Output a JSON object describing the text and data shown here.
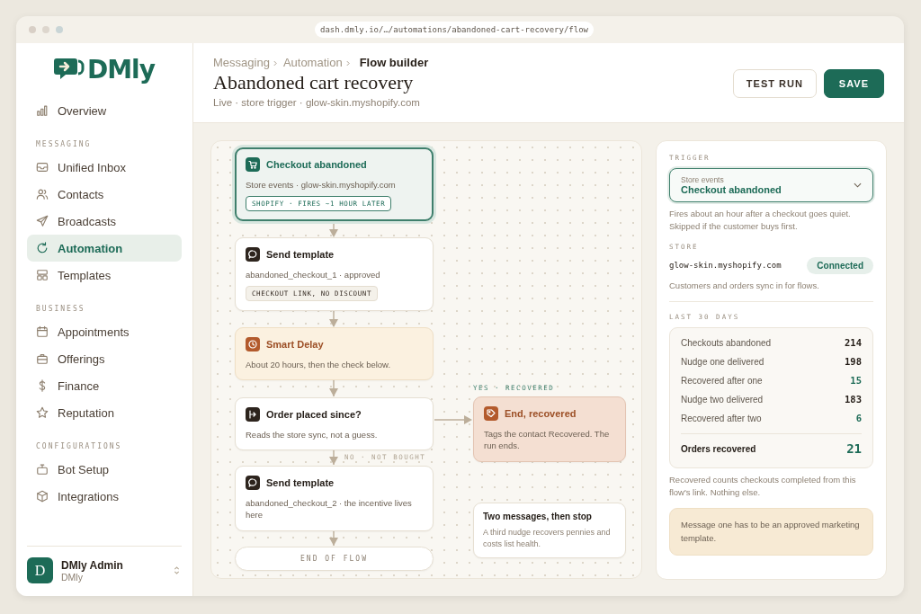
{
  "browser": {
    "url": "dash.dmly.io/…/automations/abandoned-cart-recovery/flow"
  },
  "sidebar": {
    "logo": "DMly",
    "sections": [
      {
        "items": [
          {
            "label": "Overview",
            "selected": false
          }
        ]
      },
      {
        "heading": "MESSAGING",
        "items": [
          {
            "label": "Unified Inbox",
            "selected": false
          },
          {
            "label": "Contacts",
            "selected": false
          },
          {
            "label": "Broadcasts",
            "selected": false
          },
          {
            "label": "Automation",
            "selected": true
          },
          {
            "label": "Templates",
            "selected": false
          }
        ]
      },
      {
        "heading": "BUSINESS",
        "items": [
          {
            "label": "Appointments",
            "selected": false
          },
          {
            "label": "Offerings",
            "selected": false
          },
          {
            "label": "Finance",
            "selected": false
          },
          {
            "label": "Reputation",
            "selected": false
          }
        ]
      },
      {
        "heading": "CONFIGURATIONS",
        "items": [
          {
            "label": "Bot Setup",
            "selected": false
          },
          {
            "label": "Integrations",
            "selected": false
          }
        ]
      }
    ],
    "user": {
      "initial": "D",
      "name": "DMly Admin",
      "org": "DMly"
    }
  },
  "header": {
    "breadcrumbs": [
      "Messaging",
      "Automation",
      "Flow builder"
    ],
    "title": "Abandoned cart recovery",
    "subtitle": "Live · store trigger · glow-skin.myshopify.com",
    "buttons": [
      {
        "label": "TEST RUN",
        "kind": "secondary"
      },
      {
        "label": "SAVE",
        "kind": "primary"
      }
    ]
  },
  "flow": {
    "nodes": [
      {
        "kind": "trigger",
        "title": "Checkout abandoned",
        "text": "Store events · glow-skin.myshopify.com",
        "tag": "SHOPIFY · FIRES ~1 HOUR LATER"
      },
      {
        "kind": "message",
        "title": "Send template",
        "text": "abandoned_checkout_1 · approved",
        "tag": "CHECKOUT LINK, NO DISCOUNT"
      },
      {
        "kind": "delay",
        "title": "Smart Delay",
        "text": "About 20 hours, then the check below."
      },
      {
        "kind": "condition",
        "title": "Order placed since?",
        "text": "Reads the store sync, not a guess."
      },
      {
        "kind": "message",
        "title": "Send template",
        "text": "abandoned_checkout_2 · the incentive lives here"
      },
      {
        "kind": "terminal",
        "title": "END OF FLOW"
      },
      {
        "kind": "end",
        "title": "End, recovered",
        "text": "Tags the contact Recovered. The run ends."
      },
      {
        "kind": "note",
        "title": "Two messages, then stop",
        "text": "A third nudge recovers pennies and costs list health."
      }
    ],
    "branches": [
      {
        "kind": "yes",
        "label": "YES · RECOVERED"
      },
      {
        "kind": "no",
        "label": "NO · NOT BOUGHT"
      }
    ]
  },
  "panel": {
    "trigger": {
      "heading": "TRIGGER",
      "select_label": "Store events",
      "select_value": "Checkout abandoned",
      "note": "Fires about an hour after a checkout goes quiet. Skipped if the customer buys first."
    },
    "store": {
      "heading": "STORE",
      "domain": "glow-skin.myshopify.com",
      "status": "Connected",
      "note": "Customers and orders sync in for flows."
    },
    "stats": {
      "heading": "LAST 30 DAYS",
      "rows": [
        {
          "label": "Checkouts abandoned",
          "value": "214",
          "kind": "count"
        },
        {
          "label": "Nudge one delivered",
          "value": "198",
          "kind": "count"
        },
        {
          "label": "Recovered after one",
          "value": "15",
          "kind": "recovered"
        },
        {
          "label": "Nudge two delivered",
          "value": "183",
          "kind": "count"
        },
        {
          "label": "Recovered after two",
          "value": "6",
          "kind": "recovered"
        },
        {
          "label": "Orders recovered",
          "value": "21",
          "kind": "total"
        }
      ],
      "note": "Recovered counts checkouts completed from this flow's link. Nothing else."
    },
    "warning": "Message one has to be an approved marketing template."
  }
}
